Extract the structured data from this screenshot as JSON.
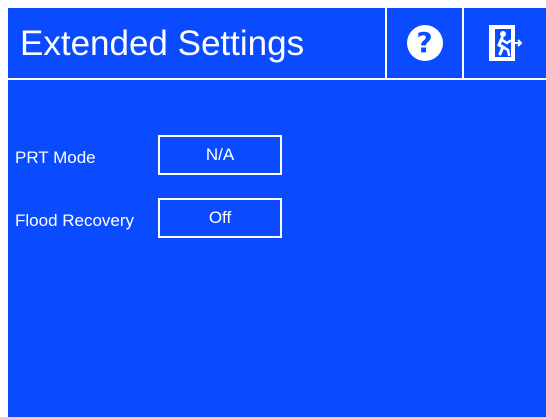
{
  "header": {
    "title": "Extended Settings",
    "help_icon": "help-question-icon",
    "exit_icon": "exit-door-icon"
  },
  "settings": [
    {
      "label": "PRT Mode",
      "value": "N/A"
    },
    {
      "label": "Flood Recovery",
      "value": "Off"
    }
  ],
  "colors": {
    "background": "#0a4bff",
    "foreground": "#ffffff"
  }
}
